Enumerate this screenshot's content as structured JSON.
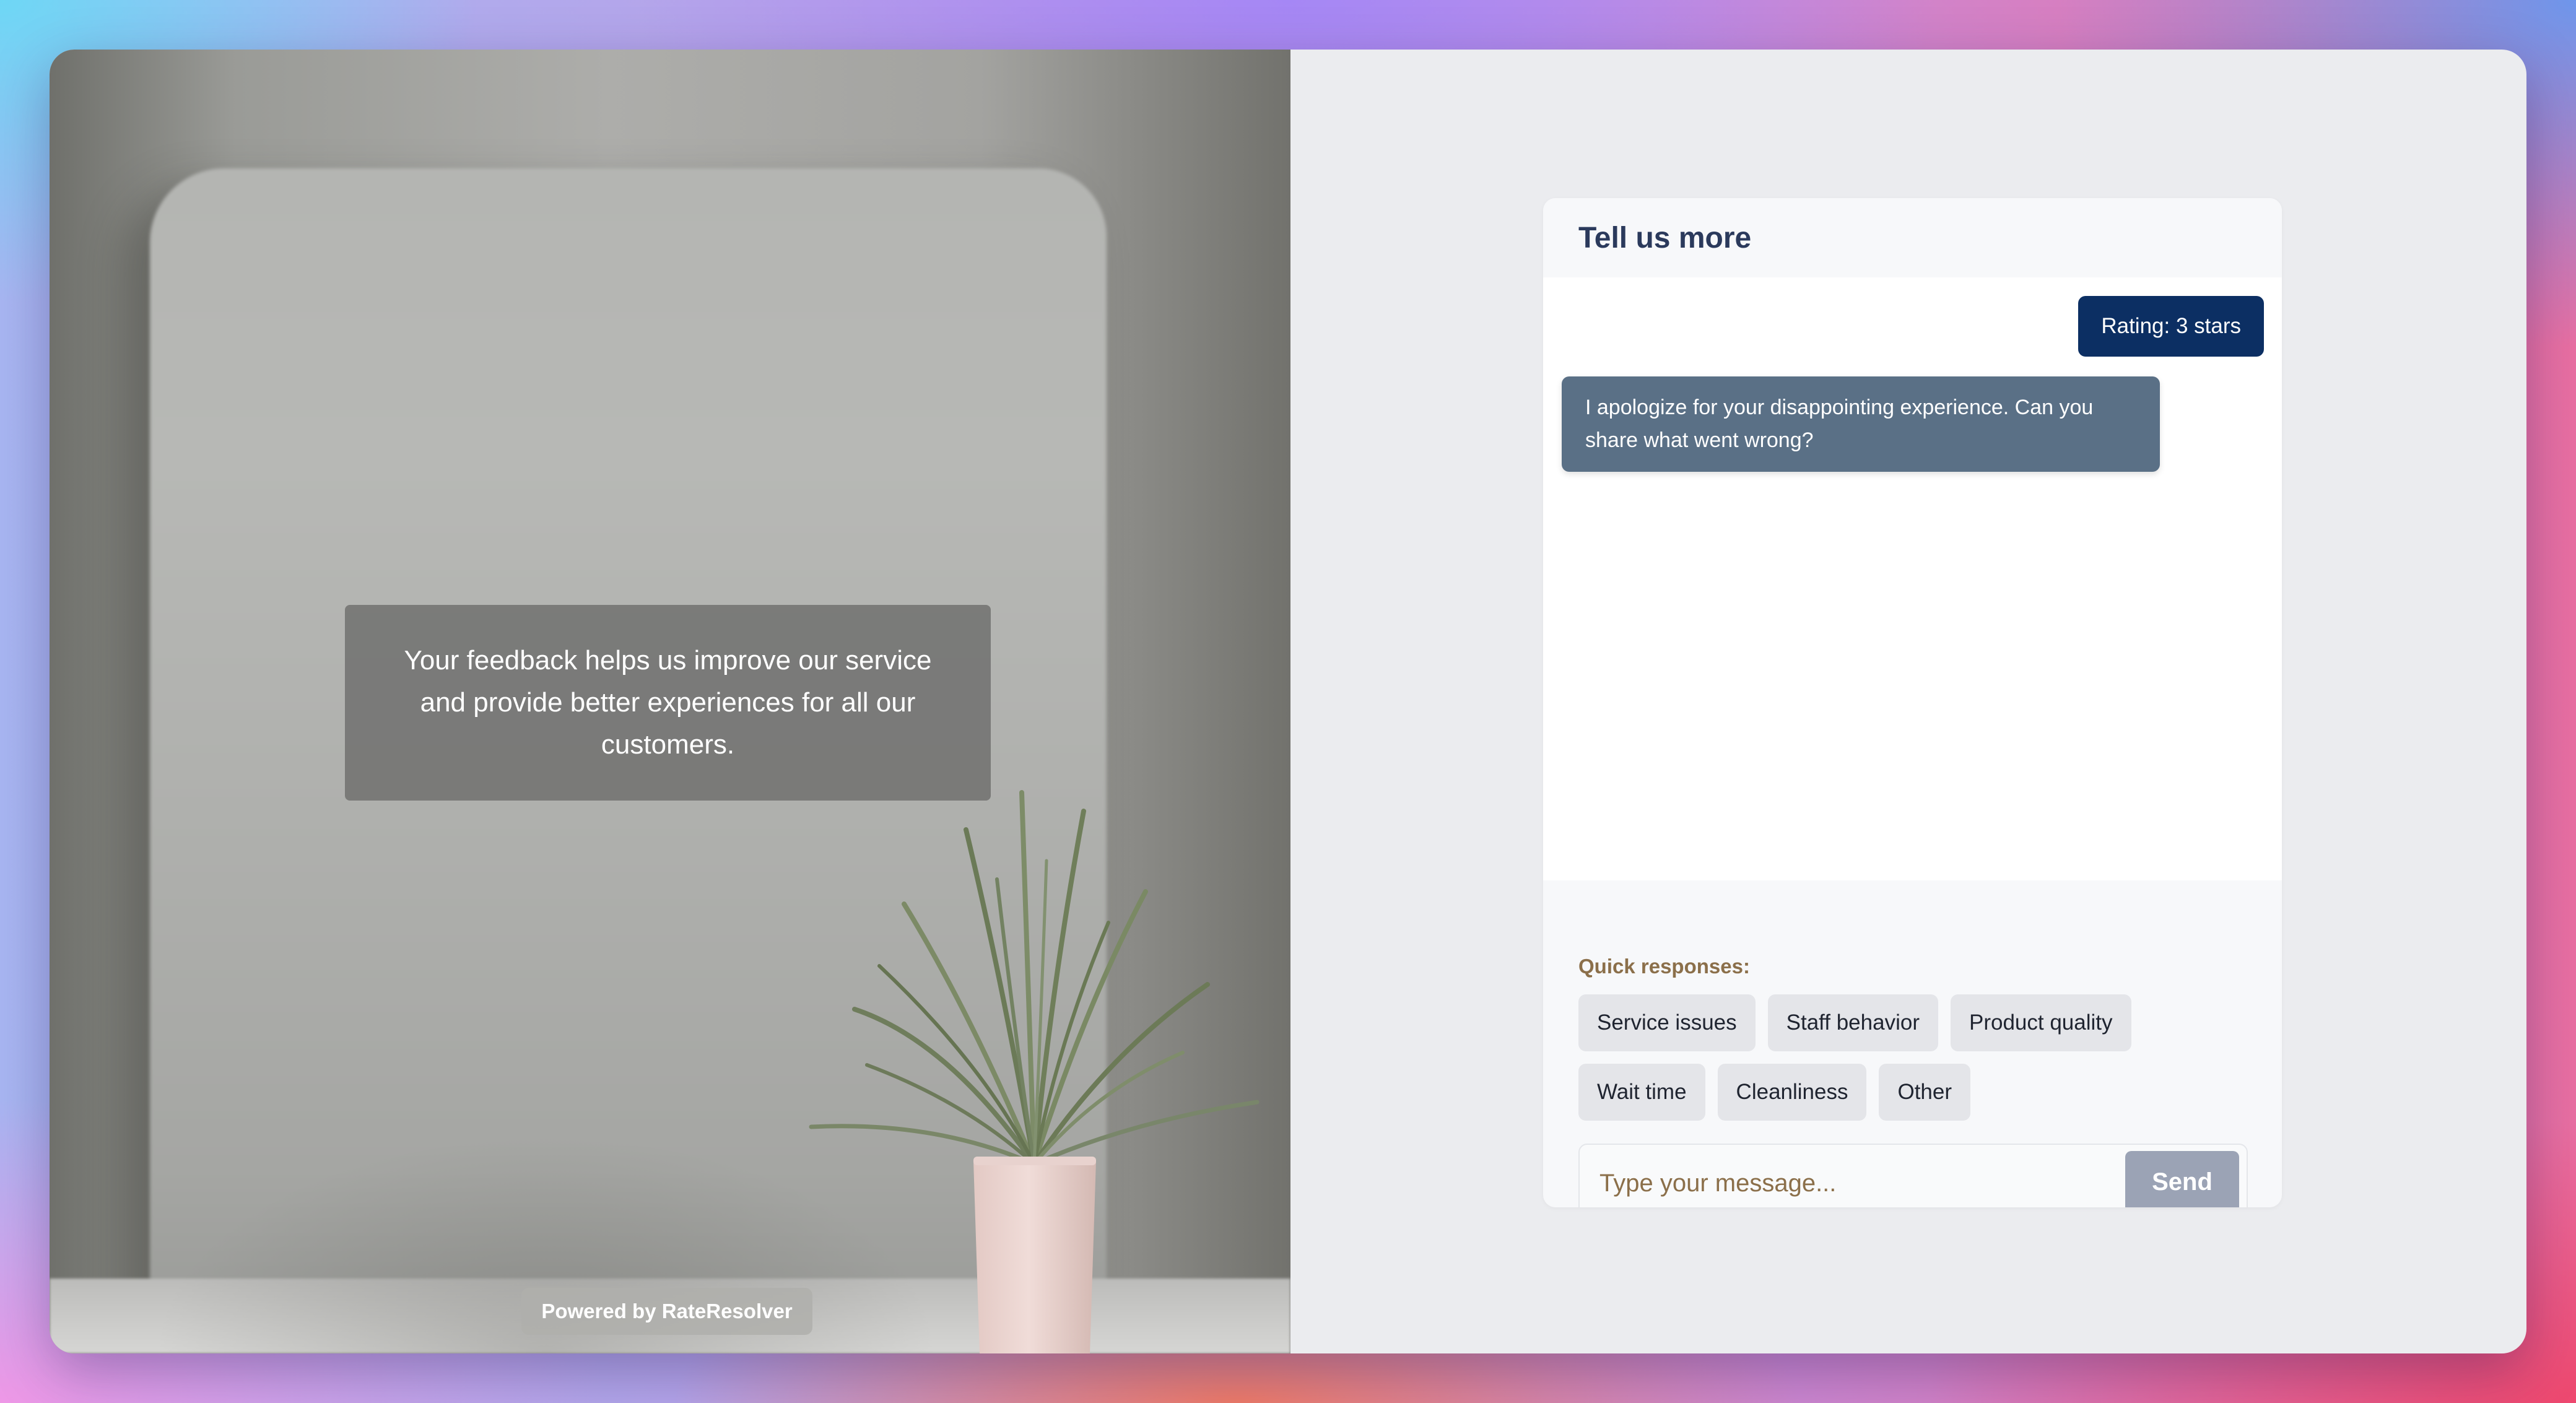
{
  "left_panel": {
    "quote": "Your feedback helps us improve our service and provide better experiences for all our customers.",
    "powered_by": "Powered by RateResolver"
  },
  "chat": {
    "title": "Tell us more",
    "messages": [
      {
        "role": "user",
        "text": "Rating: 3 stars"
      },
      {
        "role": "bot",
        "text": "I apologize for your disappointing experience. Can you share what went wrong?"
      }
    ],
    "quick_responses_label": "Quick responses:",
    "quick_responses": [
      "Service issues",
      "Staff behavior",
      "Product quality",
      "Wait time",
      "Cleanliness",
      "Other"
    ],
    "input_placeholder": "Type your message...",
    "send_label": "Send"
  },
  "colors": {
    "user_bubble": "#0c2f63",
    "bot_bubble": "#5a7086",
    "send_button": "#9ba3b5",
    "accent_text": "#8b6f4a"
  }
}
